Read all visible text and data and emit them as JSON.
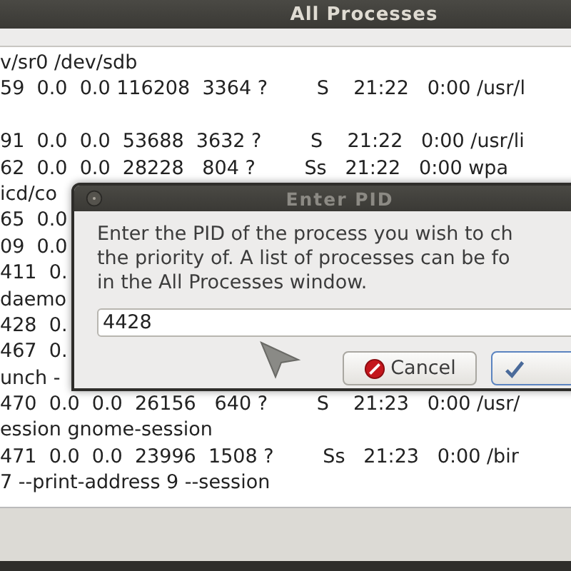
{
  "window": {
    "title": "All Processes"
  },
  "lines": [
    {
      "kind": "text",
      "text": "v/sr0 /dev/sdb"
    },
    {
      "kind": "text",
      "text": "59  0.0  0.0 116208  3364 ?        S    21:22   0:00 /usr/l"
    },
    {
      "kind": "blank"
    },
    {
      "kind": "text",
      "text": "91  0.0  0.0  53688  3632 ?        S    21:22   0:00 /usr/li"
    },
    {
      "kind": "text",
      "text": "62  0.0  0.0  28228   804 ?        Ss   21:22   0:00 wpa"
    },
    {
      "kind": "text",
      "text": "icd/co"
    },
    {
      "kind": "text",
      "text": "65  0.0"
    },
    {
      "kind": "text",
      "text": "09  0.0"
    },
    {
      "kind": "text",
      "text": "411  0."
    },
    {
      "kind": "text",
      "text": "daemo"
    },
    {
      "kind": "text",
      "text": "428  0."
    },
    {
      "kind": "text",
      "text": "467  0."
    },
    {
      "kind": "text",
      "text": "unch -"
    },
    {
      "kind": "text",
      "text": "470  0.0  0.0  26156   640 ?        S    21:23   0:00 /usr/"
    },
    {
      "kind": "text",
      "text": "ession gnome-session"
    },
    {
      "kind": "text",
      "text": "471  0.0  0.0  23996  1508 ?        Ss   21:23   0:00 /bir"
    },
    {
      "kind": "text",
      "text": "7 --print-address 9 --session"
    }
  ],
  "dialog": {
    "title": "Enter PID",
    "message": "Enter the PID of the process you wish to ch\nthe priority of. A list of processes can be fo\nin the All Processes window.",
    "field": {
      "value": "4428"
    },
    "cancel_button": "Cancel"
  }
}
